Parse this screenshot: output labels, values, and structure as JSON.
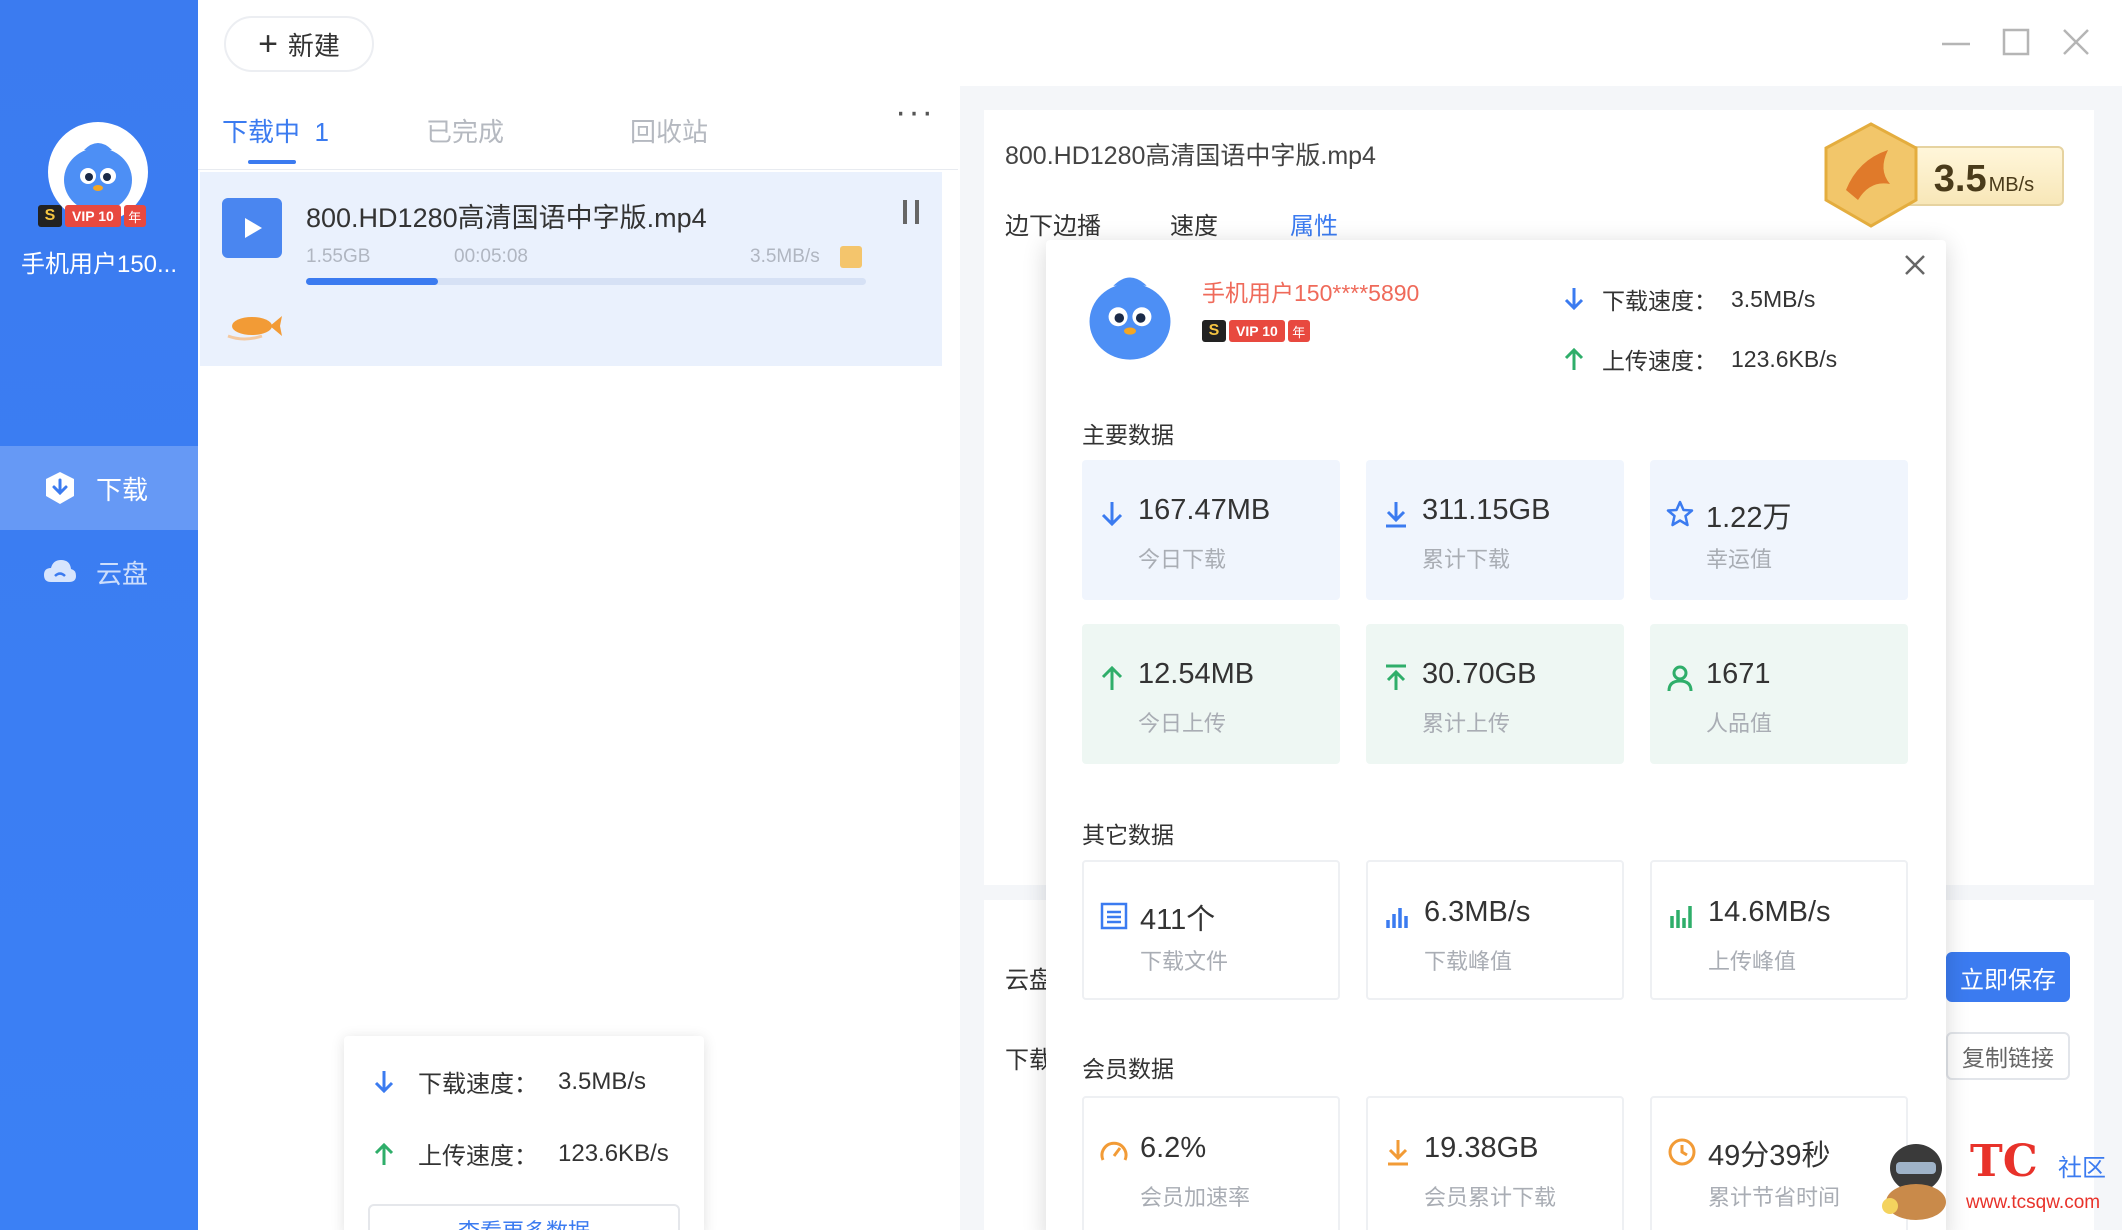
{
  "sidebar": {
    "username": "手机用户150...",
    "vip": {
      "s": "S",
      "level": "VIP 10",
      "year": "年"
    },
    "nav": [
      {
        "label": "下载",
        "icon": "download-shield-icon",
        "active": true
      },
      {
        "label": "云盘",
        "icon": "cloud-icon",
        "active": false
      }
    ]
  },
  "toolbar": {
    "new_label": "新建"
  },
  "tabs": [
    {
      "label": "下载中",
      "count": "1",
      "active": true
    },
    {
      "label": "已完成",
      "active": false
    },
    {
      "label": "回收站",
      "active": false
    }
  ],
  "task": {
    "name": "800.HD1280高清国语中字版.mp4",
    "size": "1.55GB",
    "time": "00:05:08",
    "speed": "3.5MB/s",
    "progress": 0.235
  },
  "mini_stats": {
    "download_label": "下载速度：",
    "download_value": "3.5MB/s",
    "upload_label": "上传速度：",
    "upload_value": "123.6KB/s",
    "more_button": "查看更多数据"
  },
  "detail": {
    "file_title": "800.HD1280高清国语中字版.mp4",
    "tabs": [
      "边下边播",
      "速度",
      "属性"
    ],
    "active_tab": 2,
    "speed_badge": {
      "value": "3.5",
      "unit": "MB/s"
    },
    "cloud_label": "云盘",
    "download_label": "下载",
    "save_button": "立即保存",
    "copy_button": "复制链接"
  },
  "popup": {
    "username": "手机用户150****5890",
    "download_speed_label": "下载速度：",
    "download_speed": "3.5MB/s",
    "upload_speed_label": "上传速度：",
    "upload_speed": "123.6KB/s",
    "sections": {
      "main": "主要数据",
      "other": "其它数据",
      "member": "会员数据"
    },
    "main_stats": [
      {
        "value": "167.47MB",
        "label": "今日下载",
        "icon": "arrow-down-icon",
        "tone": "blue"
      },
      {
        "value": "311.15GB",
        "label": "累计下载",
        "icon": "download-total-icon",
        "tone": "blue"
      },
      {
        "value": "1.22万",
        "label": "幸运值",
        "icon": "star-icon",
        "tone": "blue"
      },
      {
        "value": "12.54MB",
        "label": "今日上传",
        "icon": "arrow-up-icon",
        "tone": "green"
      },
      {
        "value": "30.70GB",
        "label": "累计上传",
        "icon": "upload-total-icon",
        "tone": "green"
      },
      {
        "value": "1671",
        "label": "人品值",
        "icon": "person-icon",
        "tone": "green"
      }
    ],
    "other_stats": [
      {
        "value": "411个",
        "label": "下载文件",
        "icon": "file-list-icon"
      },
      {
        "value": "6.3MB/s",
        "label": "下载峰值",
        "icon": "download-peak-icon"
      },
      {
        "value": "14.6MB/s",
        "label": "上传峰值",
        "icon": "upload-peak-icon"
      }
    ],
    "member_stats": [
      {
        "value": "6.2%",
        "label": "会员加速率",
        "icon": "speedometer-icon"
      },
      {
        "value": "19.38GB",
        "label": "会员累计下载",
        "icon": "member-download-icon"
      },
      {
        "value": "49分39秒",
        "label": "累计节省时间",
        "icon": "clock-icon"
      }
    ]
  },
  "watermark": {
    "tc": "TC",
    "community": "社区",
    "url": "www.tcsqw.com"
  },
  "colors": {
    "accent": "#3b7bf0",
    "sidebar": "#3b7bf0",
    "upload_green": "#2fae6a",
    "vip_red": "#e8493f"
  }
}
